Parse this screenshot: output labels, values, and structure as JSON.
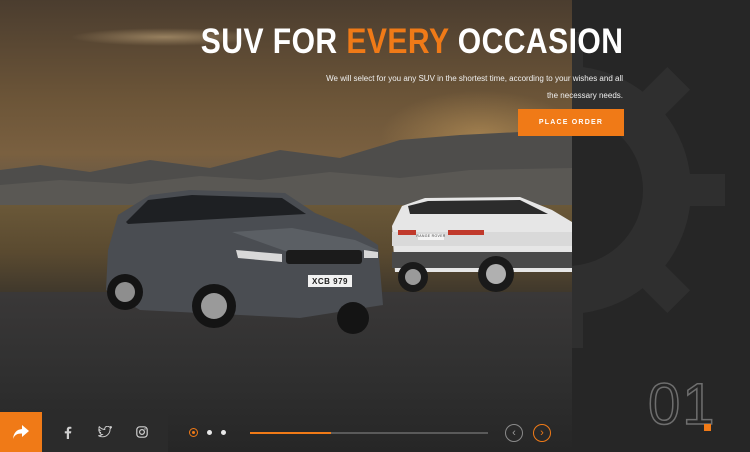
{
  "hero": {
    "title_part1": "SUV FOR ",
    "title_accent": "EVERY",
    "title_part2": " OCCASION",
    "subtitle": "We will select for you any SUV in the shortest time, according to your wishes and all the necessary needs.",
    "cta_label": "PLACE ORDER",
    "front_plate": "XCB 979",
    "rear_plate": "RANGE ROVER"
  },
  "slider": {
    "current_number": "01",
    "dots": [
      "slide-1",
      "slide-2",
      "slide-3"
    ],
    "active_index": 0,
    "progress_fraction": 0.34,
    "prev_glyph": "‹",
    "next_glyph": "›"
  },
  "social": {
    "share_icon": "share-icon",
    "items": [
      "facebook-icon",
      "twitter-icon",
      "instagram-icon"
    ]
  },
  "colors": {
    "accent": "#f07a17",
    "panel": "#262626",
    "social_bg": "#2b2b2b"
  }
}
